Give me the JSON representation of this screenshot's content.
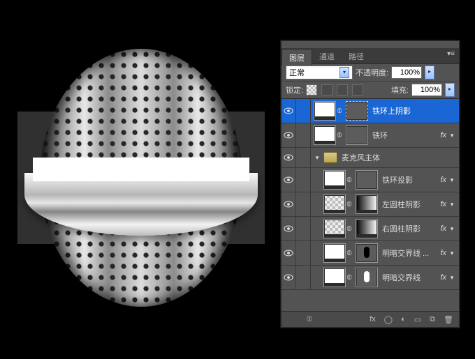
{
  "tabs": {
    "layers": "图层",
    "channels": "通道",
    "paths": "路径"
  },
  "blend": {
    "mode": "正常",
    "opacity_label": "不透明度:",
    "opacity_value": "100%",
    "lock_label": "锁定:",
    "fill_label": "填充:",
    "fill_value": "100%"
  },
  "glyph": {
    "eye": "👁",
    "link": "⦶",
    "fx": "fx",
    "expand": "▾",
    "collapse": "▸",
    "menu": "▾≡",
    "panel_collapse": "◂◂",
    "panel_close": "✕"
  },
  "layers": [
    {
      "kind": "layer",
      "name": "铁环上阴影",
      "selected": true,
      "indent": 0,
      "thumbs": [
        "white",
        "link",
        "dark-dash"
      ],
      "fx": false
    },
    {
      "kind": "layer",
      "name": "铁环",
      "indent": 0,
      "thumbs": [
        "white",
        "link",
        "dark"
      ],
      "fx": true
    },
    {
      "kind": "group",
      "name": "麦克风主体",
      "indent": 0
    },
    {
      "kind": "layer",
      "name": "铁环投影",
      "indent": 1,
      "thumbs": [
        "white",
        "link",
        "dark"
      ],
      "fx": true
    },
    {
      "kind": "layer",
      "name": "左圆柱阴影",
      "indent": 1,
      "thumbs": [
        "trans",
        "link",
        "grad"
      ],
      "fx": true
    },
    {
      "kind": "layer",
      "name": "右圆柱阴影",
      "indent": 1,
      "thumbs": [
        "trans",
        "link",
        "grad"
      ],
      "fx": true
    },
    {
      "kind": "layer",
      "name": "明暗交界线 ...",
      "indent": 1,
      "thumbs": [
        "white",
        "link",
        "pill-blk"
      ],
      "fx": true
    },
    {
      "kind": "layer",
      "name": "明暗交界线",
      "indent": 1,
      "thumbs": [
        "white",
        "link",
        "pill-wht"
      ],
      "fx": true
    }
  ],
  "footer_icons": [
    "⦶",
    "fx",
    "◯",
    "◐",
    "▭",
    "⧉",
    "🗑"
  ]
}
